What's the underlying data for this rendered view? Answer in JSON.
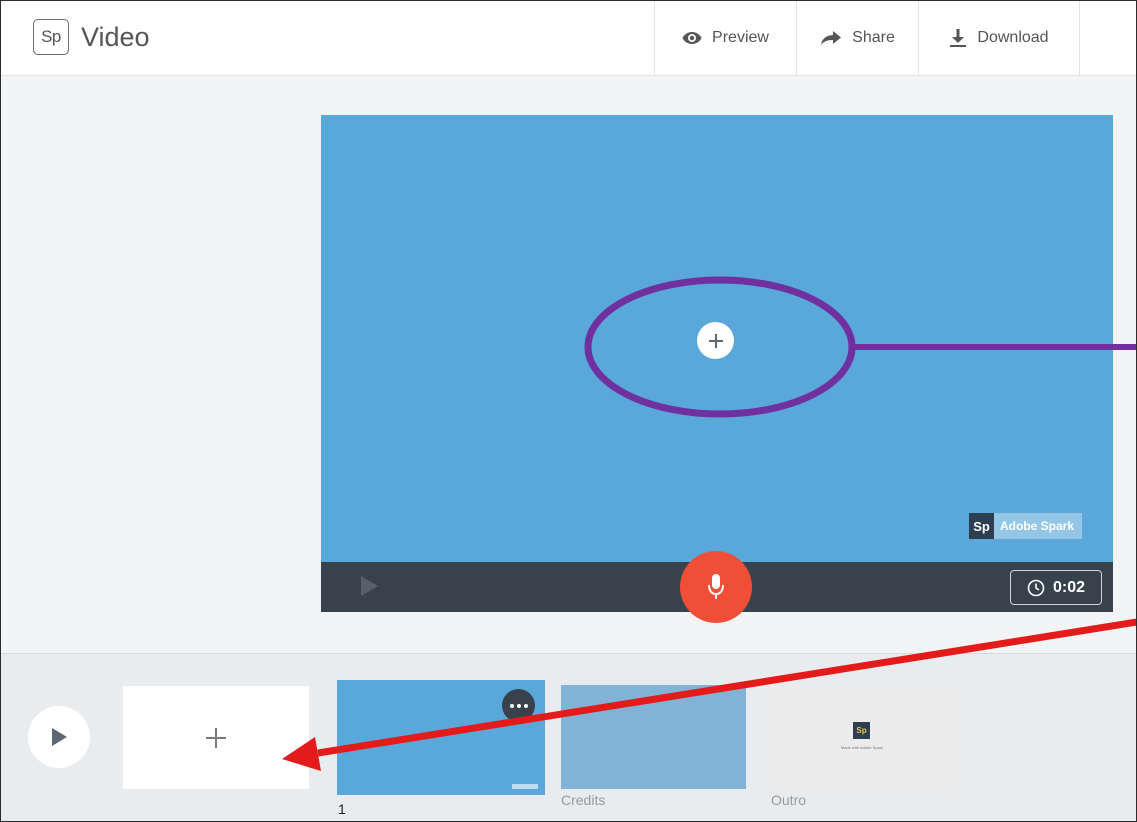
{
  "app": {
    "logo_mark": "Sp",
    "title": "Video"
  },
  "toolbar": {
    "preview_label": "Preview",
    "share_label": "Share",
    "download_label": "Download"
  },
  "canvas": {
    "background_color": "#5aa8da",
    "add_icon": "plus-icon",
    "watermark_logo": "Sp",
    "watermark_text": "Adobe Spark",
    "duration": "0:02",
    "record_color": "#f04e37"
  },
  "filmstrip": {
    "add_slide_icon": "plus-icon",
    "slides": [
      {
        "label": "1"
      },
      {
        "label": "Credits"
      },
      {
        "label": "Outro",
        "logo": "Sp",
        "caption": "Made with Adobe Spark"
      }
    ]
  },
  "annotations": {
    "ellipse_color": "#7030a0",
    "arrow_color": "#e31b1b"
  }
}
